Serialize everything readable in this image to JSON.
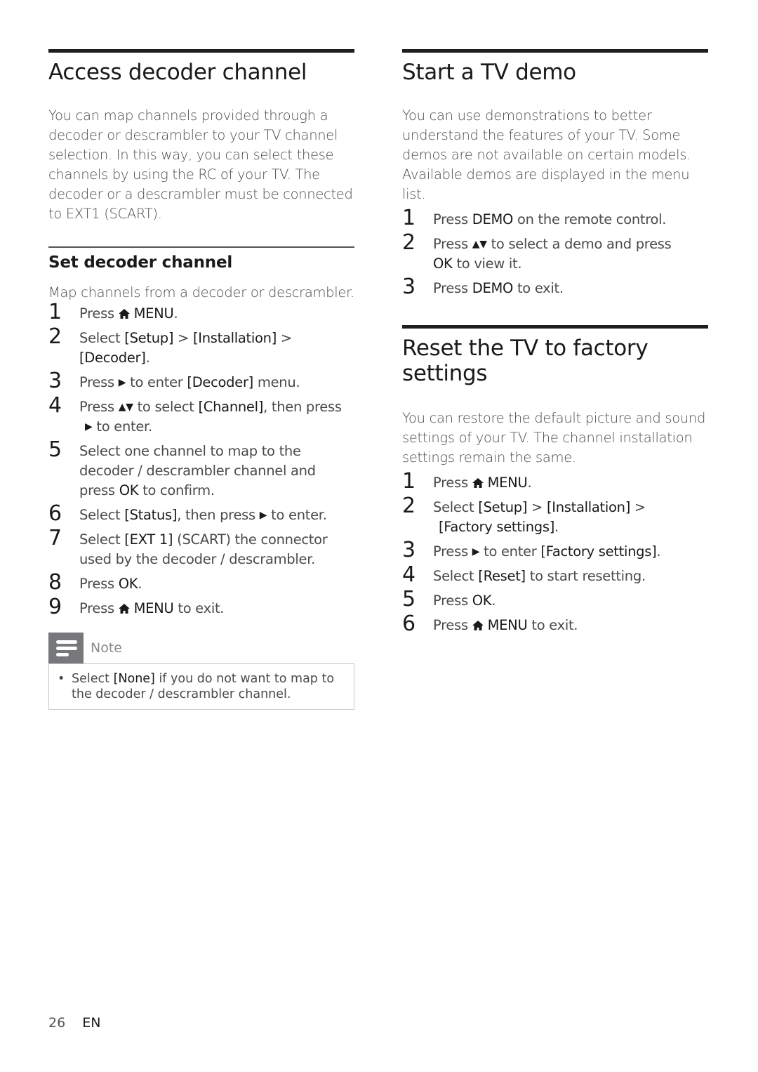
{
  "left_column": {
    "title": "Access decoder channel",
    "intro_lines": [
      "You can map channels provided through a",
      "decoder or descrambler to your TV channel",
      "selection. In this way, you can select these",
      "channels by using the RC of your TV. The",
      "decoder or a descrambler must be connected",
      "to EXT1 (SCART)."
    ],
    "subsection": {
      "title": "Set decoder channel",
      "intro": "Map channels from a decoder or descrambler.",
      "steps": [
        {
          "num": "1",
          "parts": [
            "Press ",
            "MENU",
            "."
          ]
        },
        {
          "num": "2",
          "parts": [
            "Select ",
            "[Setup]",
            " > ",
            "[Installation]",
            " > ",
            "[Decoder]",
            "."
          ]
        },
        {
          "num": "3",
          "parts": [
            "Press ",
            " to enter ",
            "[Decoder]",
            " menu."
          ]
        },
        {
          "num": "4",
          "parts": [
            "Press ",
            " to select ",
            "[Channel]",
            ", then press",
            " to enter."
          ]
        },
        {
          "num": "5",
          "parts": [
            "Select one channel to map to the decoder / descrambler channel and press ",
            "OK",
            " to confirm."
          ]
        },
        {
          "num": "6",
          "parts": [
            "Select ",
            "[Status]",
            ", then press ",
            " to enter."
          ]
        },
        {
          "num": "7",
          "parts": [
            "Select ",
            "[EXT 1]",
            " (SCART) the connector used by the decoder / descrambler."
          ]
        },
        {
          "num": "8",
          "parts": [
            "Press ",
            "OK",
            "."
          ]
        },
        {
          "num": "9",
          "parts": [
            "Press ",
            "MENU",
            " to exit."
          ]
        }
      ]
    },
    "note": {
      "label": "Note",
      "icon": "note-lines-icon",
      "bullet": "•",
      "parts": [
        "Select ",
        "[None]",
        " if you do not want to map to",
        "the decoder / descrambler channel."
      ]
    }
  },
  "right_column": {
    "demo": {
      "title": "Start a TV demo",
      "intro_lines": [
        "You can use demonstrations to better",
        "understand the features of your TV. Some",
        "demos are not available on certain models.",
        "Available demos are displayed in the menu list."
      ],
      "steps": [
        {
          "num": "1",
          "parts": [
            "Press ",
            "DEMO",
            " on the remote control."
          ]
        },
        {
          "num": "2",
          "parts": [
            "Press ",
            " to select a demo and press",
            "OK",
            " to view it."
          ]
        },
        {
          "num": "3",
          "parts": [
            "Press ",
            "DEMO",
            " to exit."
          ]
        }
      ]
    },
    "reset": {
      "title_line1": "Reset the TV to factory",
      "title_line2": "settings",
      "intro_lines": [
        "You can restore the default picture and sound",
        "settings of your TV. The channel installation",
        "settings remain the same."
      ],
      "steps": [
        {
          "num": "1",
          "parts": [
            "Press ",
            "MENU",
            "."
          ]
        },
        {
          "num": "2",
          "parts": [
            "Select ",
            "[Setup]",
            " > ",
            "[Installation]",
            " > ",
            "[Factory settings]",
            "."
          ]
        },
        {
          "num": "3",
          "parts": [
            "Press ",
            " to enter ",
            "[Factory settings]",
            "."
          ]
        },
        {
          "num": "4",
          "parts": [
            "Select ",
            "[Reset]",
            " to start resetting."
          ]
        },
        {
          "num": "5",
          "parts": [
            "Press ",
            "OK",
            "."
          ]
        },
        {
          "num": "6",
          "parts": [
            "Press ",
            "MENU",
            " to exit."
          ]
        }
      ]
    }
  },
  "symbols": {
    "right_arrow": "▶",
    "up_down": "▲▼"
  },
  "footer": {
    "page_number": "26",
    "language": "EN"
  }
}
